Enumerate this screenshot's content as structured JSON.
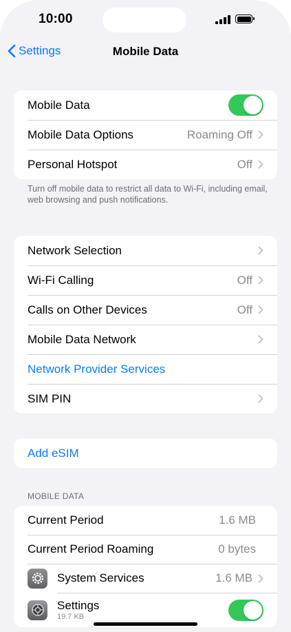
{
  "status_bar": {
    "time": "10:00"
  },
  "nav": {
    "back_label": "Settings",
    "title": "Mobile Data"
  },
  "group1": {
    "mobile_data": {
      "label": "Mobile Data",
      "toggle_on": true
    },
    "options": {
      "label": "Mobile Data Options",
      "value": "Roaming Off"
    },
    "hotspot": {
      "label": "Personal Hotspot",
      "value": "Off"
    }
  },
  "group1_footnote": "Turn off mobile data to restrict all data to Wi-Fi, including email, web browsing and push notifications.",
  "group2": {
    "network_selection": {
      "label": "Network Selection"
    },
    "wifi_calling": {
      "label": "Wi-Fi Calling",
      "value": "Off"
    },
    "calls_other": {
      "label": "Calls on Other Devices",
      "value": "Off"
    },
    "mobile_data_network": {
      "label": "Mobile Data Network"
    },
    "provider_services": {
      "label": "Network Provider Services"
    },
    "sim_pin": {
      "label": "SIM PIN"
    }
  },
  "group3": {
    "add_esim": "Add eSIM"
  },
  "usage_header": "MOBILE DATA",
  "usage": {
    "current_period": {
      "label": "Current Period",
      "value": "1.6 MB"
    },
    "current_roaming": {
      "label": "Current Period Roaming",
      "value": "0 bytes"
    },
    "system_services": {
      "label": "System Services",
      "value": "1.6 MB",
      "icon": "gear-icon"
    },
    "settings_app": {
      "label": "Settings",
      "sub": "19.7 KB",
      "icon": "settings-app-icon",
      "toggle_on": true
    }
  },
  "colors": {
    "accent": "#0a7aff",
    "toggle_on": "#34c759",
    "background": "#f2f2f7"
  }
}
